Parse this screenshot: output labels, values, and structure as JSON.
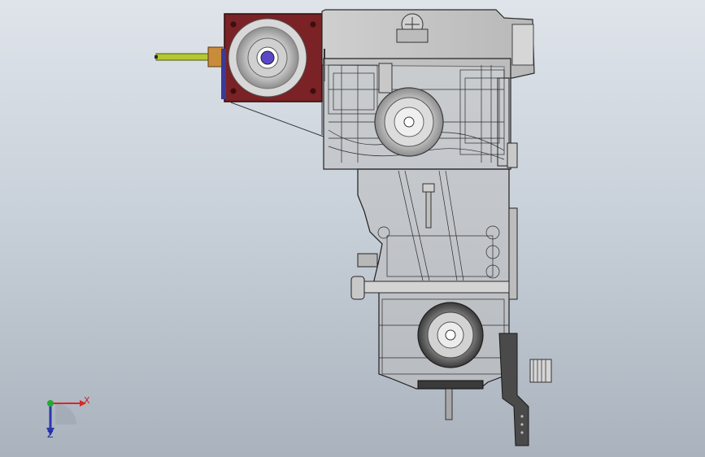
{
  "viewport": {
    "background_top": "#dfe4ea",
    "background_bottom": "#aab2bd"
  },
  "model": {
    "body_color": "#c6c6c6",
    "edge_color": "#2b2b2b",
    "flange_color": "#7a2225",
    "shaft_color": "#b5c832",
    "bracket_color": "#4a4a4a"
  },
  "triad": {
    "x_label": "X",
    "z_label": "Z",
    "x_color": "#d42a2a",
    "y_color": "#22aa33",
    "z_color": "#2a36b0"
  }
}
